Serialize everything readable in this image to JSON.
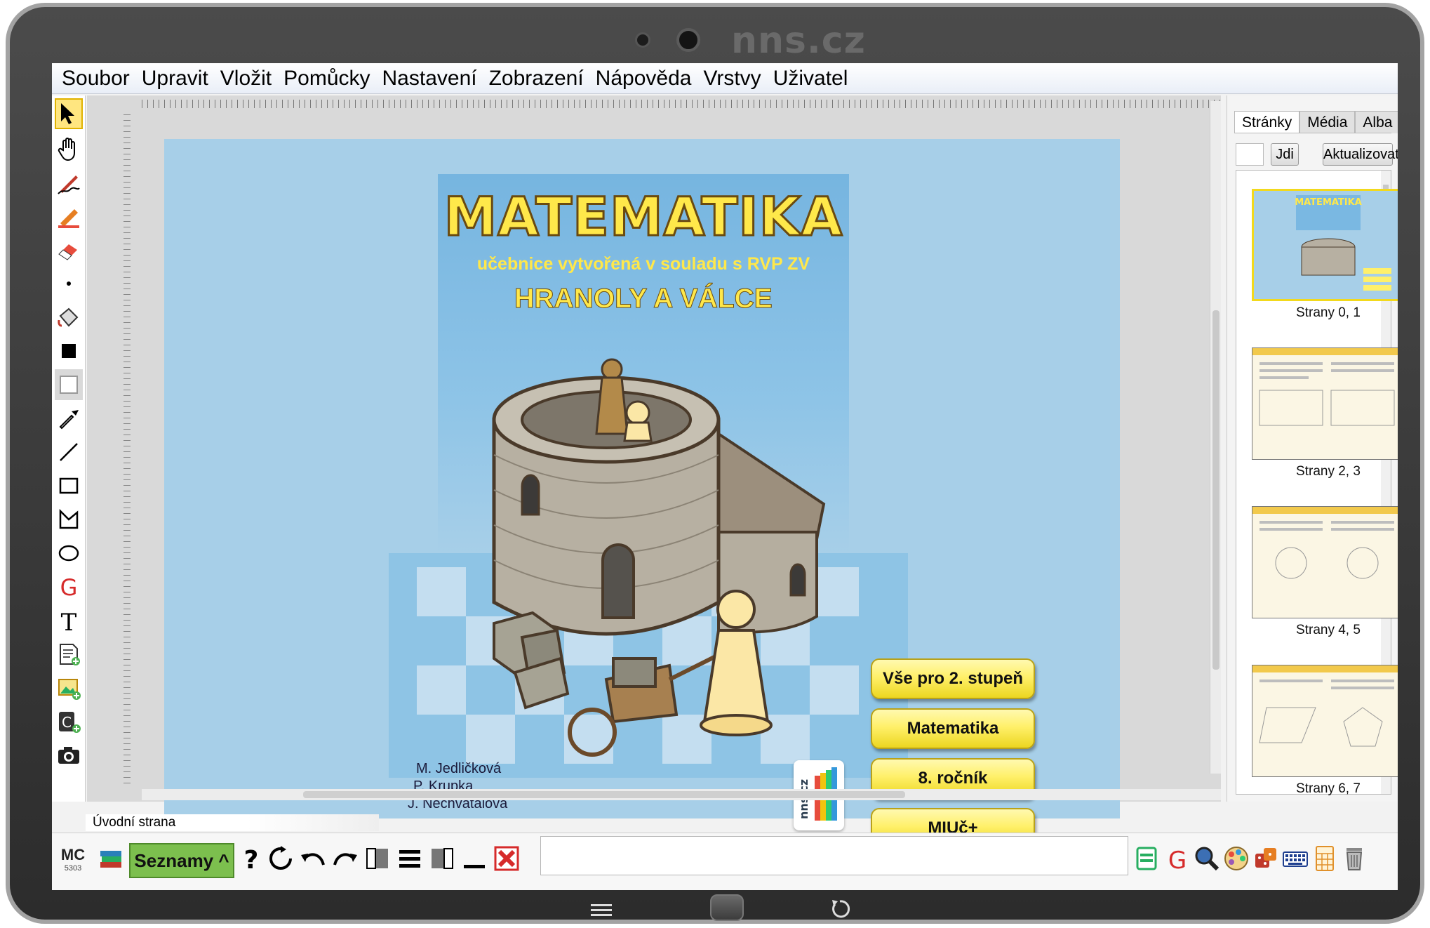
{
  "device": {
    "brand": "nns.cz"
  },
  "menu": [
    "Soubor",
    "Upravit",
    "Vložit",
    "Pomůcky",
    "Nastavení",
    "Zobrazení",
    "Nápověda",
    "Vrstvy",
    "Uživatel"
  ],
  "cover": {
    "title": "MATEMATIKA",
    "subtitle": "učebnice vytvořená v souladu s RVP ZV",
    "topic": "HRANOLY A VÁLCE",
    "authors": [
      "M. Jedličková",
      "P. Krupka",
      "J. Nechvátalová"
    ],
    "logo_text": "nns.cz",
    "buttons": [
      "Vše pro 2. stupeň",
      "Matematika",
      "8. ročník",
      "MIUč+"
    ]
  },
  "status": {
    "page_name": "Úvodní strana"
  },
  "side_panel": {
    "tabs": [
      "Stránky",
      "Média",
      "Alba"
    ],
    "go_label": "Jdi",
    "refresh_label": "Aktualizovat",
    "page_input_value": "",
    "thumbnails": [
      "Strany 0, 1",
      "Strany 2, 3",
      "Strany 4, 5",
      "Strany 6, 7"
    ]
  },
  "bottom": {
    "mc_label": "MC",
    "mc_number": "5303",
    "lists_label": "Seznamy ^",
    "command_value": ""
  },
  "colors": {
    "page_bg": "#a7cfe8",
    "title_yellow": "#ffe84a",
    "button_yellow": "#fff06a",
    "lists_green": "#7cbf4e",
    "selected_tool": "#ffe680"
  }
}
